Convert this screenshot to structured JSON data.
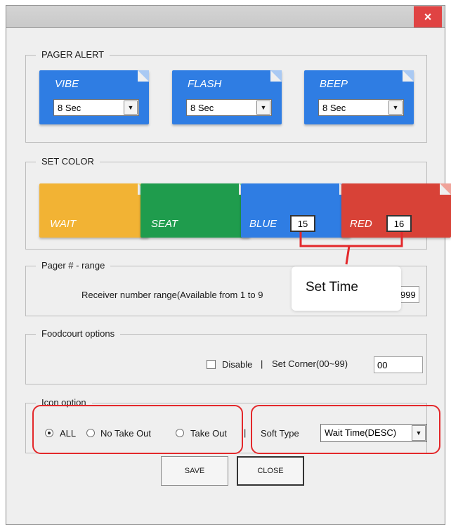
{
  "window": {
    "close_glyph": "×"
  },
  "pager_alert": {
    "title": "PAGER ALERT",
    "tiles": [
      {
        "label": "VIBE",
        "value": "8 Sec"
      },
      {
        "label": "FLASH",
        "value": "8 Sec"
      },
      {
        "label": "BEEP",
        "value": "8 Sec"
      }
    ]
  },
  "set_color": {
    "title": "SET COLOR",
    "tiles": [
      {
        "label": "WAIT"
      },
      {
        "label": "SEAT"
      },
      {
        "label": "BLUE",
        "time": "15"
      },
      {
        "label": "RED",
        "time": "16"
      }
    ]
  },
  "annotation": {
    "text": "Set Time"
  },
  "pager_range": {
    "title": "Pager # - range",
    "label": "Receiver number range(Available from 1 to 9",
    "value": "999"
  },
  "foodcourt": {
    "title": "Foodcourt options",
    "disable_label": "Disable",
    "separator": "|",
    "corner_label": "Set Corner(00~99)",
    "corner_value": "00"
  },
  "icon_option": {
    "title": "Icon option",
    "radios": [
      {
        "label": "ALL",
        "selected": true
      },
      {
        "label": "No Take Out",
        "selected": false
      },
      {
        "label": "Take Out",
        "selected": false
      }
    ],
    "separator": "|",
    "sort_label": "Soft Type",
    "sort_value": "Wait Time(DESC)"
  },
  "buttons": {
    "save": "SAVE",
    "close": "CLOSE"
  },
  "colors": {
    "blue": "#2f7de3",
    "yellow": "#f2b334",
    "green": "#1f9c4d",
    "red": "#d84237",
    "annotation": "#e3282b",
    "close": "#e04343"
  }
}
